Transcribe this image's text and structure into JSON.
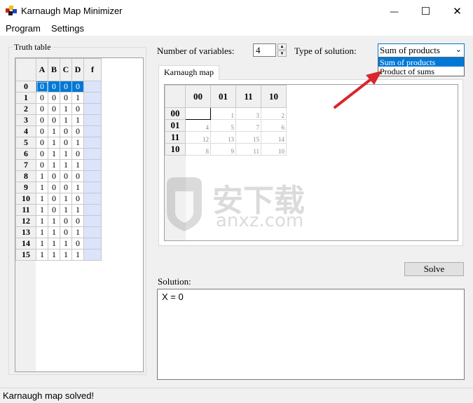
{
  "window": {
    "title": "Karnaugh Map Minimizer",
    "minimize_glyph": "—",
    "maximize_glyph": "☐",
    "close_glyph": "✕"
  },
  "menu": {
    "program": "Program",
    "settings": "Settings"
  },
  "truth_table": {
    "label": "Truth table",
    "headers": [
      "A",
      "B",
      "C",
      "D",
      "f"
    ],
    "rows": [
      {
        "index": "0",
        "bits": [
          "0",
          "0",
          "0",
          "0"
        ],
        "f": ""
      },
      {
        "index": "1",
        "bits": [
          "0",
          "0",
          "0",
          "1"
        ],
        "f": ""
      },
      {
        "index": "2",
        "bits": [
          "0",
          "0",
          "1",
          "0"
        ],
        "f": ""
      },
      {
        "index": "3",
        "bits": [
          "0",
          "0",
          "1",
          "1"
        ],
        "f": ""
      },
      {
        "index": "4",
        "bits": [
          "0",
          "1",
          "0",
          "0"
        ],
        "f": ""
      },
      {
        "index": "5",
        "bits": [
          "0",
          "1",
          "0",
          "1"
        ],
        "f": ""
      },
      {
        "index": "6",
        "bits": [
          "0",
          "1",
          "1",
          "0"
        ],
        "f": ""
      },
      {
        "index": "7",
        "bits": [
          "0",
          "1",
          "1",
          "1"
        ],
        "f": ""
      },
      {
        "index": "8",
        "bits": [
          "1",
          "0",
          "0",
          "0"
        ],
        "f": ""
      },
      {
        "index": "9",
        "bits": [
          "1",
          "0",
          "0",
          "1"
        ],
        "f": ""
      },
      {
        "index": "10",
        "bits": [
          "1",
          "0",
          "1",
          "0"
        ],
        "f": ""
      },
      {
        "index": "11",
        "bits": [
          "1",
          "0",
          "1",
          "1"
        ],
        "f": ""
      },
      {
        "index": "12",
        "bits": [
          "1",
          "1",
          "0",
          "0"
        ],
        "f": ""
      },
      {
        "index": "13",
        "bits": [
          "1",
          "1",
          "0",
          "1"
        ],
        "f": ""
      },
      {
        "index": "14",
        "bits": [
          "1",
          "1",
          "1",
          "0"
        ],
        "f": ""
      },
      {
        "index": "15",
        "bits": [
          "1",
          "1",
          "1",
          "1"
        ],
        "f": ""
      }
    ],
    "selected_row": 0
  },
  "controls": {
    "num_vars_label": "Number of variables:",
    "num_vars_value": "4",
    "solution_type_label": "Type of solution:",
    "solution_type_value": "Sum of products",
    "solution_type_options": [
      "Sum of products",
      "Product of sums"
    ]
  },
  "tab": {
    "label": "Karnaugh map"
  },
  "kmap": {
    "col_headers": [
      "00",
      "01",
      "11",
      "10"
    ],
    "row_headers": [
      "00",
      "01",
      "11",
      "10"
    ],
    "cells": [
      [
        "",
        "1",
        "3",
        "2"
      ],
      [
        "4",
        "5",
        "7",
        "6"
      ],
      [
        "12",
        "13",
        "15",
        "14"
      ],
      [
        "8",
        "9",
        "11",
        "10"
      ]
    ]
  },
  "solve_button": "Solve",
  "solution": {
    "label": "Solution:",
    "text": "X = 0"
  },
  "status": "Karnaugh map solved!",
  "watermark": {
    "cn": "安下载",
    "en": "anxz.com"
  },
  "colors": {
    "selection": "#0078d7",
    "f_column": "#dbe4fb",
    "arrow": "#d9262c"
  }
}
